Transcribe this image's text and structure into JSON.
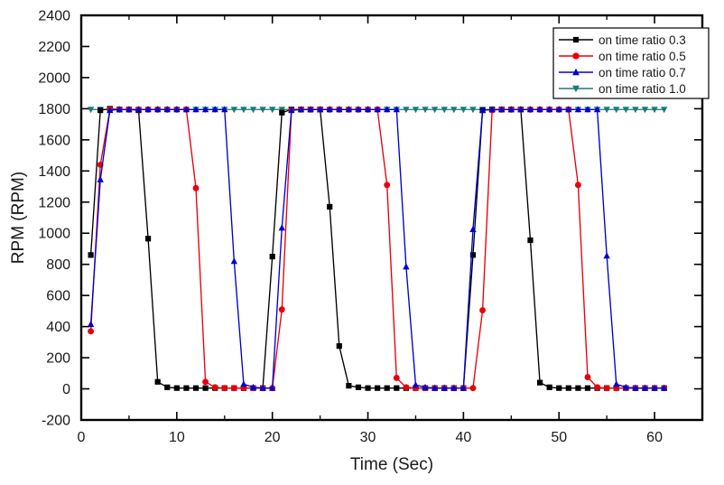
{
  "chart_data": {
    "type": "line",
    "title": "",
    "xlabel": "Time (Sec)",
    "ylabel": "RPM (RPM)",
    "xlim": [
      0,
      65
    ],
    "ylim": [
      -200,
      2400
    ],
    "xticks": [
      0,
      10,
      20,
      30,
      40,
      50,
      60
    ],
    "xtick_labels": [
      "0",
      "10",
      "20",
      "30",
      "40",
      "50",
      "60"
    ],
    "xtick_minor": [
      5,
      15,
      25,
      35,
      45,
      55
    ],
    "yticks": [
      -200,
      0,
      200,
      400,
      600,
      800,
      1000,
      1200,
      1400,
      1600,
      1800,
      2000,
      2200,
      2400
    ],
    "ytick_labels": [
      "-200",
      "0",
      "200",
      "400",
      "600",
      "800",
      "1000",
      "1200",
      "1400",
      "1600",
      "1800",
      "2000",
      "2200",
      "2400"
    ],
    "grid": false,
    "legend_position": "top-right",
    "series": [
      {
        "name": "on time ratio 0.3",
        "color": "#000000",
        "marker": "square",
        "x": [
          1,
          2,
          3,
          4,
          5,
          6,
          7,
          8,
          9,
          10,
          11,
          12,
          13,
          14,
          15,
          16,
          17,
          18,
          19,
          20,
          21,
          22,
          23,
          24,
          25,
          26,
          27,
          28,
          29,
          30,
          31,
          32,
          33,
          34,
          35,
          36,
          37,
          38,
          39,
          40,
          41,
          42,
          43,
          44,
          45,
          46,
          47,
          48,
          49,
          50,
          51,
          52,
          53,
          54,
          55,
          56,
          57,
          58,
          59,
          60,
          61
        ],
        "y": [
          860,
          1790,
          1800,
          1795,
          1795,
          1790,
          965,
          45,
          10,
          5,
          5,
          5,
          5,
          5,
          5,
          5,
          5,
          5,
          5,
          850,
          1775,
          1795,
          1795,
          1795,
          1795,
          1170,
          275,
          20,
          10,
          5,
          5,
          5,
          5,
          5,
          5,
          5,
          5,
          5,
          5,
          5,
          860,
          1790,
          1795,
          1795,
          1795,
          1795,
          955,
          40,
          10,
          5,
          5,
          5,
          5,
          5,
          5,
          5,
          5,
          5,
          5,
          5,
          5
        ]
      },
      {
        "name": "on time ratio 0.5",
        "color": "#e8000b",
        "marker": "circle",
        "x": [
          1,
          2,
          3,
          4,
          5,
          6,
          7,
          8,
          9,
          10,
          11,
          12,
          13,
          14,
          15,
          16,
          17,
          18,
          19,
          20,
          21,
          22,
          23,
          24,
          25,
          26,
          27,
          28,
          29,
          30,
          31,
          32,
          33,
          34,
          35,
          36,
          37,
          38,
          39,
          40,
          41,
          42,
          43,
          44,
          45,
          46,
          47,
          48,
          49,
          50,
          51,
          52,
          53,
          54,
          55,
          56,
          57,
          58,
          59,
          60,
          61
        ],
        "y": [
          370,
          1440,
          1795,
          1795,
          1795,
          1795,
          1795,
          1795,
          1795,
          1795,
          1795,
          1290,
          45,
          10,
          5,
          5,
          5,
          5,
          5,
          5,
          510,
          1790,
          1795,
          1795,
          1795,
          1795,
          1795,
          1795,
          1795,
          1795,
          1795,
          1310,
          70,
          10,
          5,
          5,
          5,
          5,
          5,
          5,
          5,
          505,
          1790,
          1795,
          1795,
          1795,
          1795,
          1795,
          1795,
          1795,
          1795,
          1310,
          75,
          10,
          5,
          5,
          5,
          5,
          5,
          5,
          5
        ]
      },
      {
        "name": "on time ratio 0.7",
        "color": "#0000cd",
        "marker": "triangle-up",
        "x": [
          1,
          2,
          3,
          4,
          5,
          6,
          7,
          8,
          9,
          10,
          11,
          12,
          13,
          14,
          15,
          16,
          17,
          18,
          19,
          20,
          21,
          22,
          23,
          24,
          25,
          26,
          27,
          28,
          29,
          30,
          31,
          32,
          33,
          34,
          35,
          36,
          37,
          38,
          39,
          40,
          41,
          42,
          43,
          44,
          45,
          46,
          47,
          48,
          49,
          50,
          51,
          52,
          53,
          54,
          55,
          56,
          57,
          58,
          59,
          60,
          61
        ],
        "y": [
          415,
          1345,
          1790,
          1795,
          1795,
          1795,
          1795,
          1795,
          1795,
          1795,
          1795,
          1795,
          1795,
          1795,
          1795,
          820,
          30,
          10,
          5,
          5,
          1035,
          1790,
          1795,
          1795,
          1795,
          1795,
          1795,
          1795,
          1795,
          1795,
          1795,
          1795,
          1795,
          785,
          25,
          10,
          5,
          5,
          5,
          5,
          1025,
          1790,
          1795,
          1795,
          1795,
          1795,
          1795,
          1795,
          1795,
          1795,
          1795,
          1795,
          1795,
          1795,
          855,
          30,
          10,
          5,
          5,
          5,
          5
        ]
      },
      {
        "name": "on time ratio 1.0",
        "color": "#1a7a7a",
        "marker": "triangle-down",
        "x": [
          1,
          2,
          3,
          4,
          5,
          6,
          7,
          8,
          9,
          10,
          11,
          12,
          13,
          14,
          15,
          16,
          17,
          18,
          19,
          20,
          21,
          22,
          23,
          24,
          25,
          26,
          27,
          28,
          29,
          30,
          31,
          32,
          33,
          34,
          35,
          36,
          37,
          38,
          39,
          40,
          41,
          42,
          43,
          44,
          45,
          46,
          47,
          48,
          49,
          50,
          51,
          52,
          53,
          54,
          55,
          56,
          57,
          58,
          59,
          60,
          61
        ],
        "y": [
          1795,
          1795,
          1795,
          1795,
          1795,
          1795,
          1795,
          1795,
          1795,
          1795,
          1795,
          1795,
          1795,
          1795,
          1795,
          1795,
          1795,
          1795,
          1795,
          1795,
          1795,
          1795,
          1795,
          1795,
          1795,
          1795,
          1795,
          1795,
          1795,
          1795,
          1795,
          1795,
          1795,
          1795,
          1795,
          1795,
          1795,
          1795,
          1795,
          1795,
          1795,
          1795,
          1795,
          1795,
          1795,
          1795,
          1795,
          1795,
          1795,
          1795,
          1795,
          1795,
          1795,
          1795,
          1795,
          1795,
          1795,
          1795,
          1795,
          1795,
          1795
        ]
      }
    ]
  }
}
